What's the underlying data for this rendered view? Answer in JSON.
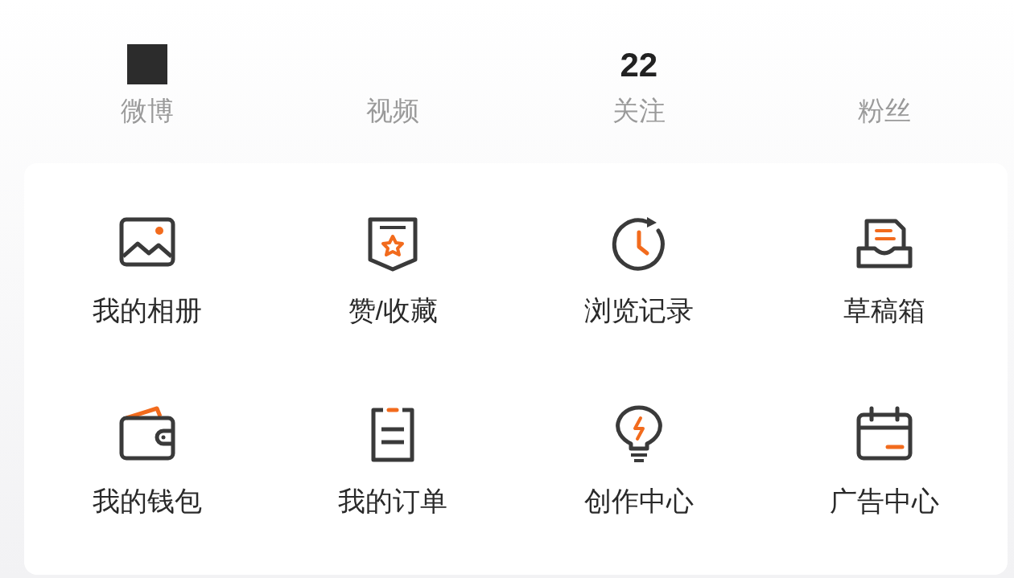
{
  "stats": [
    {
      "label": "微博",
      "value_hidden": true
    },
    {
      "label": "视频"
    },
    {
      "label": "关注",
      "value": "22"
    },
    {
      "label": "粉丝"
    }
  ],
  "grid": [
    {
      "label": "我的相册",
      "kind": "album"
    },
    {
      "label": "赞/收藏",
      "kind": "favorites"
    },
    {
      "label": "浏览记录",
      "kind": "history"
    },
    {
      "label": "草稿箱",
      "kind": "drafts"
    },
    {
      "label": "我的钱包",
      "kind": "wallet"
    },
    {
      "label": "我的订单",
      "kind": "orders"
    },
    {
      "label": "创作中心",
      "kind": "creator"
    },
    {
      "label": "广告中心",
      "kind": "ads"
    }
  ]
}
